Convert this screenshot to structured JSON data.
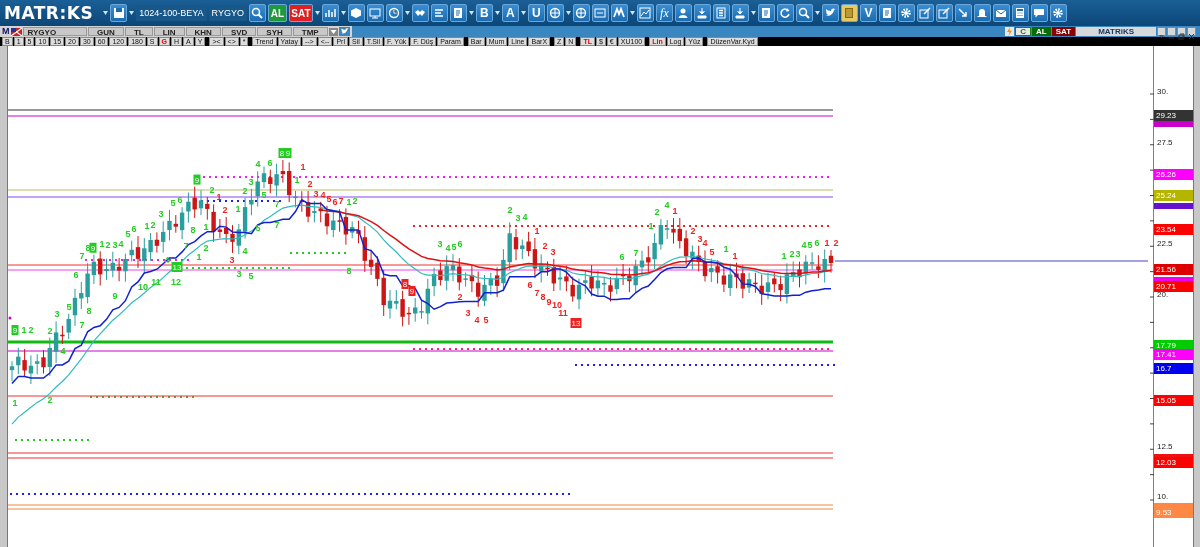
{
  "toolbar": {
    "logo": "MATR:KS",
    "layout": "1024-100-BEYA",
    "symbol": "RYGYO",
    "text_buttons": [
      {
        "label": "AL",
        "kind": "buy"
      },
      {
        "label": "SAT",
        "kind": "sell"
      },
      {
        "label": "B",
        "kind": "plain"
      },
      {
        "label": "A",
        "kind": "plain"
      },
      {
        "label": "U",
        "kind": "plain"
      },
      {
        "label": "fx",
        "kind": "script"
      },
      {
        "label": "V",
        "kind": "plain"
      }
    ]
  },
  "chart_window": {
    "logo_letter": "M",
    "symbol": "RYGYO",
    "header_buttons": [
      "GUN",
      "TL",
      "LIN",
      "KHN",
      "SVD",
      "SYH",
      "TMP"
    ],
    "tool_groups": [
      [
        {
          "label": "B",
          "selected": false
        },
        {
          "label": "1",
          "selected": false
        },
        {
          "label": "5",
          "selected": false
        },
        {
          "label": "10",
          "selected": false
        },
        {
          "label": "15",
          "selected": false
        },
        {
          "label": "20",
          "selected": false
        },
        {
          "label": "30",
          "selected": false
        },
        {
          "label": "60",
          "selected": false
        },
        {
          "label": "120",
          "selected": false
        },
        {
          "label": "180",
          "selected": false
        },
        {
          "label": "S",
          "selected": false
        },
        {
          "label": "G",
          "selected": true
        },
        {
          "label": "H",
          "selected": false
        },
        {
          "label": "A",
          "selected": false
        },
        {
          "label": "Y",
          "selected": false
        }
      ],
      [
        {
          "label": "><",
          "selected": false
        },
        {
          "label": "<>",
          "selected": false
        },
        {
          "label": "*",
          "selected": false
        }
      ],
      [
        {
          "label": "Trend",
          "selected": false
        },
        {
          "label": "Yatay",
          "selected": false
        },
        {
          "label": "-->",
          "selected": false
        },
        {
          "label": "<--",
          "selected": false
        },
        {
          "label": "Prl",
          "selected": false
        },
        {
          "label": "Sil",
          "selected": false
        },
        {
          "label": "T.Sil",
          "selected": false
        },
        {
          "label": "F. Yük",
          "selected": false
        },
        {
          "label": "F. Düş",
          "selected": false
        },
        {
          "label": "Param",
          "selected": false
        }
      ],
      [
        {
          "label": "Bar",
          "selected": false
        },
        {
          "label": "Mum",
          "selected": false
        },
        {
          "label": "Line",
          "selected": false
        },
        {
          "label": "BarX",
          "selected": false
        }
      ],
      [
        {
          "label": "Z",
          "selected": false
        },
        {
          "label": "N",
          "selected": false
        }
      ],
      [
        {
          "label": "TL",
          "selected": true
        },
        {
          "label": "$",
          "selected": false
        },
        {
          "label": "€",
          "selected": false
        },
        {
          "label": "XU100",
          "selected": false
        }
      ],
      [
        {
          "label": "Lin",
          "selected": true
        },
        {
          "label": "Log",
          "selected": false
        },
        {
          "label": "Yüz",
          "selected": false
        }
      ],
      [
        {
          "label": "DüzenVar.Kyd",
          "selected": false
        }
      ]
    ],
    "right_controls": {
      "c_button": "C",
      "buy_button": "AL",
      "sell_button": "SAT",
      "brand": "MATRiKS"
    }
  },
  "axis": {
    "ticks": [
      "30.",
      "27.5",
      "22.5",
      "20.",
      "12.5",
      "10."
    ],
    "price_tags": [
      {
        "label": "29.23",
        "color": "#333333"
      },
      {
        "label": "26.26",
        "color": "#ff00ff"
      },
      {
        "label": "25.24",
        "color": "#b5b500"
      },
      {
        "label": "23.54",
        "color": "#ff0000"
      },
      {
        "label": "21.56",
        "color": "#dd0000"
      },
      {
        "label": "20.71",
        "color": "#ff0000"
      },
      {
        "label": "17.79",
        "color": "#00cc00"
      },
      {
        "label": "17.41",
        "color": "#ff00ff"
      },
      {
        "label": "16.7",
        "color": "#0000ee"
      },
      {
        "label": "15.05",
        "color": "#ff0000"
      },
      {
        "label": "12.03",
        "color": "#ff0000"
      },
      {
        "label": "9.53",
        "color": "#ff8844"
      }
    ]
  },
  "sequence_counts": [
    {
      "label": "1",
      "color": "#22cc22",
      "boxed": false
    },
    {
      "label": "9",
      "color": "#22cc22",
      "boxed": true
    },
    {
      "label": "1",
      "color": "#22cc22",
      "boxed": false
    },
    {
      "label": "2",
      "color": "#22cc22",
      "boxed": false
    },
    {
      "label": "2",
      "color": "#22cc22",
      "boxed": false
    },
    {
      "label": "2",
      "color": "#22cc22",
      "boxed": false
    },
    {
      "label": "3",
      "color": "#22cc22",
      "boxed": false
    },
    {
      "label": "4",
      "color": "#22cc22",
      "boxed": false
    },
    {
      "label": "5",
      "color": "#22cc22",
      "boxed": false
    },
    {
      "label": "6",
      "color": "#22cc22",
      "boxed": false
    },
    {
      "label": "7",
      "color": "#22cc22",
      "boxed": false
    },
    {
      "label": "8",
      "color": "#22cc22",
      "boxed": false
    },
    {
      "label": "9",
      "color": "#22cc22",
      "boxed": false
    },
    {
      "label": "10",
      "color": "#22cc22",
      "boxed": false
    },
    {
      "label": "11",
      "color": "#22cc22",
      "boxed": false
    },
    {
      "label": "13",
      "color": "#22cc22",
      "boxed": true
    },
    {
      "label": "12",
      "color": "#22cc22",
      "boxed": false
    },
    {
      "label": "7",
      "color": "#22cc22",
      "boxed": false
    },
    {
      "label": "8",
      "color": "#22cc22",
      "boxed": false
    },
    {
      "label": "9",
      "color": "#22cc22",
      "boxed": true
    },
    {
      "label": "1",
      "color": "#22cc22",
      "boxed": false
    },
    {
      "label": "2",
      "color": "#22cc22",
      "boxed": false
    },
    {
      "label": "3",
      "color": "#22cc22",
      "boxed": false
    },
    {
      "label": "4",
      "color": "#22cc22",
      "boxed": false
    },
    {
      "label": "5",
      "color": "#22cc22",
      "boxed": false
    },
    {
      "label": "6",
      "color": "#22cc22",
      "boxed": false
    },
    {
      "label": "1",
      "color": "#22cc22",
      "boxed": false
    },
    {
      "label": "2",
      "color": "#22cc22",
      "boxed": false
    },
    {
      "label": "3",
      "color": "#22cc22",
      "boxed": false
    },
    {
      "label": "4",
      "color": "#22cc22",
      "boxed": false
    },
    {
      "label": "5",
      "color": "#22cc22",
      "boxed": false
    },
    {
      "label": "6",
      "color": "#22cc22",
      "boxed": false
    },
    {
      "label": "7",
      "color": "#22cc22",
      "boxed": false
    },
    {
      "label": "8",
      "color": "#22cc22",
      "boxed": false
    },
    {
      "label": "9",
      "color": "#22cc22",
      "boxed": true
    },
    {
      "label": "1",
      "color": "#22cc22",
      "boxed": false
    },
    {
      "label": "2",
      "color": "#22cc22",
      "boxed": false
    },
    {
      "label": "1",
      "color": "#ee2222",
      "boxed": false
    },
    {
      "label": "2",
      "color": "#ee2222",
      "boxed": false
    },
    {
      "label": "1",
      "color": "#22cc22",
      "boxed": false
    },
    {
      "label": "2",
      "color": "#22cc22",
      "boxed": false
    },
    {
      "label": "3",
      "color": "#ee2222",
      "boxed": false
    },
    {
      "label": "4",
      "color": "#22cc22",
      "boxed": false
    },
    {
      "label": "1",
      "color": "#22cc22",
      "boxed": false
    },
    {
      "label": "2",
      "color": "#22cc22",
      "boxed": false
    },
    {
      "label": "3",
      "color": "#22cc22",
      "boxed": false
    },
    {
      "label": "4",
      "color": "#22cc22",
      "boxed": false
    },
    {
      "label": "5",
      "color": "#22cc22",
      "boxed": false
    },
    {
      "label": "6",
      "color": "#22cc22",
      "boxed": false
    },
    {
      "label": "7",
      "color": "#22cc22",
      "boxed": false
    },
    {
      "label": "8",
      "color": "#22cc22",
      "boxed": true
    },
    {
      "label": "9",
      "color": "#22cc22",
      "boxed": true
    },
    {
      "label": "1",
      "color": "#22cc22",
      "boxed": false
    },
    {
      "label": "1",
      "color": "#ee2222",
      "boxed": false
    },
    {
      "label": "2",
      "color": "#ee2222",
      "boxed": false
    },
    {
      "label": "5",
      "color": "#22cc22",
      "boxed": false
    },
    {
      "label": "7",
      "color": "#22cc22",
      "boxed": false
    },
    {
      "label": "3",
      "color": "#22cc22",
      "boxed": false
    },
    {
      "label": "5",
      "color": "#22cc22",
      "boxed": false
    },
    {
      "label": "3",
      "color": "#ee2222",
      "boxed": false
    },
    {
      "label": "4",
      "color": "#ee2222",
      "boxed": false
    },
    {
      "label": "5",
      "color": "#ee2222",
      "boxed": false
    },
    {
      "label": "6",
      "color": "#ee2222",
      "boxed": false
    },
    {
      "label": "7",
      "color": "#ee2222",
      "boxed": false
    },
    {
      "label": "1",
      "color": "#22cc22",
      "boxed": false
    },
    {
      "label": "2",
      "color": "#22cc22",
      "boxed": false
    },
    {
      "label": "8",
      "color": "#22cc22",
      "boxed": false
    },
    {
      "label": "8",
      "color": "#ee2222",
      "boxed": true
    },
    {
      "label": "9",
      "color": "#ee2222",
      "boxed": true
    },
    {
      "label": "3",
      "color": "#22cc22",
      "boxed": false
    },
    {
      "label": "4",
      "color": "#22cc22",
      "boxed": false
    },
    {
      "label": "5",
      "color": "#22cc22",
      "boxed": false
    },
    {
      "label": "6",
      "color": "#22cc22",
      "boxed": false
    },
    {
      "label": "2",
      "color": "#22cc22",
      "boxed": false
    },
    {
      "label": "3",
      "color": "#22cc22",
      "boxed": false
    },
    {
      "label": "4",
      "color": "#22cc22",
      "boxed": false
    },
    {
      "label": "1",
      "color": "#ee2222",
      "boxed": false
    },
    {
      "label": "2",
      "color": "#ee2222",
      "boxed": false
    },
    {
      "label": "3",
      "color": "#ee2222",
      "boxed": false
    },
    {
      "label": "2",
      "color": "#ee2222",
      "boxed": false
    },
    {
      "label": "3",
      "color": "#ee2222",
      "boxed": false
    },
    {
      "label": "4",
      "color": "#ee2222",
      "boxed": false
    },
    {
      "label": "5",
      "color": "#ee2222",
      "boxed": false
    },
    {
      "label": "6",
      "color": "#ee2222",
      "boxed": false
    },
    {
      "label": "7",
      "color": "#ee2222",
      "boxed": false
    },
    {
      "label": "8",
      "color": "#ee2222",
      "boxed": false
    },
    {
      "label": "9",
      "color": "#ee2222",
      "boxed": false
    },
    {
      "label": "10",
      "color": "#ee2222",
      "boxed": false
    },
    {
      "label": "11",
      "color": "#ee2222",
      "boxed": false
    },
    {
      "label": "13",
      "color": "#ee2222",
      "boxed": true
    },
    {
      "label": "6",
      "color": "#22cc22",
      "boxed": false
    },
    {
      "label": "7",
      "color": "#22cc22",
      "boxed": false
    },
    {
      "label": "1",
      "color": "#22cc22",
      "boxed": false
    },
    {
      "label": "2",
      "color": "#22cc22",
      "boxed": false
    },
    {
      "label": "4",
      "color": "#22cc22",
      "boxed": false
    },
    {
      "label": "1",
      "color": "#ee2222",
      "boxed": false
    },
    {
      "label": "2",
      "color": "#ee2222",
      "boxed": false
    },
    {
      "label": "3",
      "color": "#ee2222",
      "boxed": false
    },
    {
      "label": "4",
      "color": "#ee2222",
      "boxed": false
    },
    {
      "label": "5",
      "color": "#ee2222",
      "boxed": false
    },
    {
      "label": "1",
      "color": "#22cc22",
      "boxed": false
    },
    {
      "label": "1",
      "color": "#ee2222",
      "boxed": false
    },
    {
      "label": "1",
      "color": "#22cc22",
      "boxed": false
    },
    {
      "label": "2",
      "color": "#22cc22",
      "boxed": false
    },
    {
      "label": "3",
      "color": "#22cc22",
      "boxed": false
    },
    {
      "label": "4",
      "color": "#22cc22",
      "boxed": false
    },
    {
      "label": "5",
      "color": "#22cc22",
      "boxed": false
    },
    {
      "label": "6",
      "color": "#22cc22",
      "boxed": false
    },
    {
      "label": "1",
      "color": "#ee2222",
      "boxed": false
    },
    {
      "label": "2",
      "color": "#ee2222",
      "boxed": false
    }
  ]
}
